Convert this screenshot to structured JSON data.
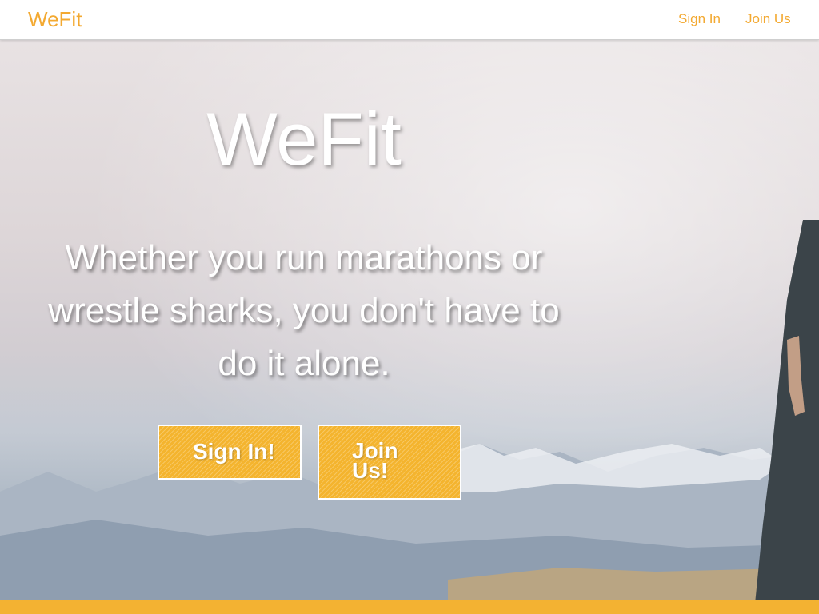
{
  "nav": {
    "brand": "WeFit",
    "sign_in": "Sign In",
    "join_us": "Join Us"
  },
  "hero": {
    "title": "WeFit",
    "tagline": "Whether you run marathons or wrestle sharks, you don't have to do it alone.",
    "sign_in_button": "Sign In!",
    "join_button": "Join Us!"
  },
  "colors": {
    "accent": "#f3a931",
    "button_fill": "#f4b42e",
    "footer_bar": "#f3b232"
  }
}
